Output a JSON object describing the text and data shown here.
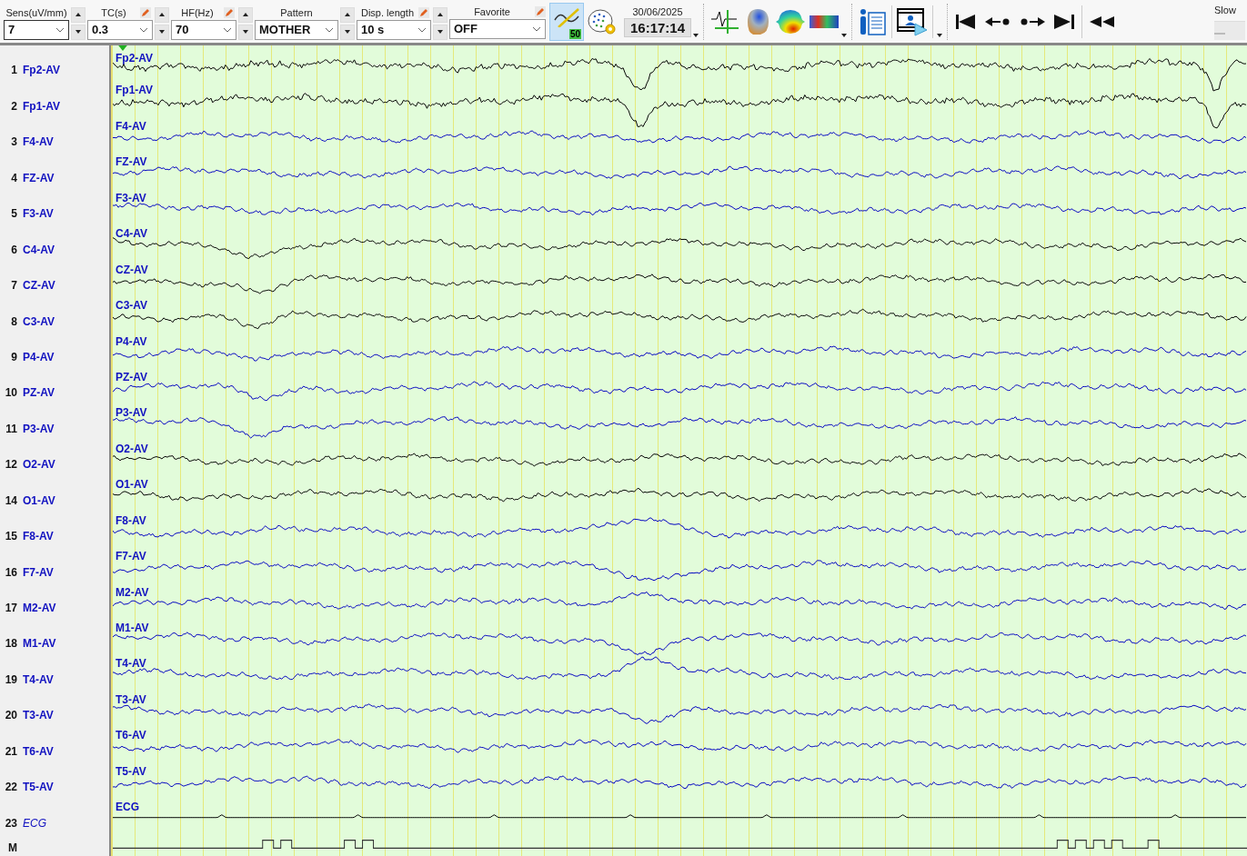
{
  "toolbar": {
    "selectors": [
      {
        "label": "Sens(uV/mm)",
        "value": "7",
        "editable": false,
        "spin": true
      },
      {
        "label": "TC(s)",
        "value": "0.3",
        "editable": true,
        "spin": true
      },
      {
        "label": "HF(Hz)",
        "value": "70",
        "editable": true,
        "spin": true
      },
      {
        "label": "Pattern",
        "value": "MOTHER",
        "editable": false,
        "spin": true
      },
      {
        "label": "Disp. length",
        "value": "10 s",
        "editable": true,
        "spin": true
      },
      {
        "label": "Favorite",
        "value": "OFF",
        "editable": true,
        "spin": false
      }
    ],
    "notch": {
      "label": "50",
      "on": true
    },
    "date": "30/06/2025",
    "time": "16:17:14",
    "speed": {
      "label": "Slow",
      "level": 0
    }
  },
  "channels": [
    {
      "number": "1",
      "name": "Fp2-AV",
      "trace_label": "Fp2-AV",
      "color": "#000000",
      "kind": "eeg"
    },
    {
      "number": "2",
      "name": "Fp1-AV",
      "trace_label": "Fp1-AV",
      "color": "#000000",
      "kind": "eeg"
    },
    {
      "number": "3",
      "name": "F4-AV",
      "trace_label": "F4-AV",
      "color": "#0000c0",
      "kind": "eeg"
    },
    {
      "number": "4",
      "name": "FZ-AV",
      "trace_label": "FZ-AV",
      "color": "#0000c0",
      "kind": "eeg"
    },
    {
      "number": "5",
      "name": "F3-AV",
      "trace_label": "F3-AV",
      "color": "#0000c0",
      "kind": "eeg"
    },
    {
      "number": "6",
      "name": "C4-AV",
      "trace_label": "C4-AV",
      "color": "#000000",
      "kind": "eeg"
    },
    {
      "number": "7",
      "name": "CZ-AV",
      "trace_label": "CZ-AV",
      "color": "#000000",
      "kind": "eeg"
    },
    {
      "number": "8",
      "name": "C3-AV",
      "trace_label": "C3-AV",
      "color": "#000000",
      "kind": "eeg"
    },
    {
      "number": "9",
      "name": "P4-AV",
      "trace_label": "P4-AV",
      "color": "#0000c0",
      "kind": "eeg"
    },
    {
      "number": "10",
      "name": "PZ-AV",
      "trace_label": "PZ-AV",
      "color": "#0000c0",
      "kind": "eeg"
    },
    {
      "number": "11",
      "name": "P3-AV",
      "trace_label": "P3-AV",
      "color": "#0000c0",
      "kind": "eeg"
    },
    {
      "number": "12",
      "name": "O2-AV",
      "trace_label": "O2-AV",
      "color": "#000000",
      "kind": "eeg"
    },
    {
      "number": "14",
      "name": "O1-AV",
      "trace_label": "O1-AV",
      "color": "#000000",
      "kind": "eeg"
    },
    {
      "number": "15",
      "name": "F8-AV",
      "trace_label": "F8-AV",
      "color": "#0000c0",
      "kind": "eeg"
    },
    {
      "number": "16",
      "name": "F7-AV",
      "trace_label": "F7-AV",
      "color": "#0000c0",
      "kind": "eeg"
    },
    {
      "number": "17",
      "name": "M2-AV",
      "trace_label": "M2-AV",
      "color": "#0000c0",
      "kind": "eeg"
    },
    {
      "number": "18",
      "name": "M1-AV",
      "trace_label": "M1-AV",
      "color": "#0000c0",
      "kind": "eeg"
    },
    {
      "number": "19",
      "name": "T4-AV",
      "trace_label": "T4-AV",
      "color": "#0000c0",
      "kind": "eeg"
    },
    {
      "number": "20",
      "name": "T3-AV",
      "trace_label": "T3-AV",
      "color": "#0000c0",
      "kind": "eeg"
    },
    {
      "number": "21",
      "name": "T6-AV",
      "trace_label": "T6-AV",
      "color": "#0000c0",
      "kind": "eeg"
    },
    {
      "number": "22",
      "name": "T5-AV",
      "trace_label": "T5-AV",
      "color": "#0000c0",
      "kind": "eeg"
    },
    {
      "number": "23",
      "name": "ECG",
      "trace_label": "ECG",
      "color": "#000000",
      "kind": "ecg"
    }
  ],
  "marker_row": {
    "label": "M"
  }
}
